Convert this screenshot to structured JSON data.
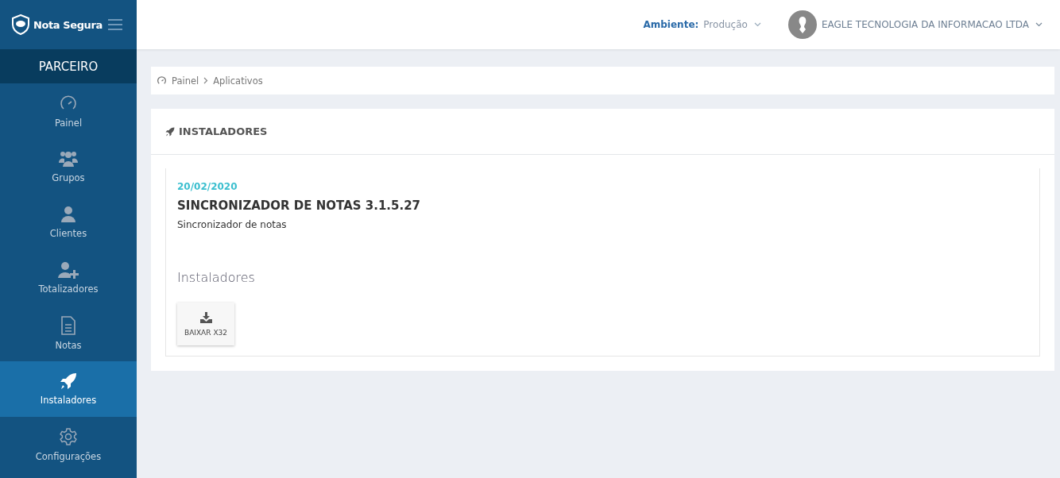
{
  "brand": {
    "name": "Nota Segura"
  },
  "sidebar": {
    "section": "PARCEIRO",
    "items": [
      {
        "label": "Painel",
        "selected": false
      },
      {
        "label": "Grupos",
        "selected": false
      },
      {
        "label": "Clientes",
        "selected": false
      },
      {
        "label": "Totalizadores",
        "selected": false
      },
      {
        "label": "Notas",
        "selected": false
      },
      {
        "label": "Instaladores",
        "selected": true
      },
      {
        "label": "Configurações",
        "selected": false
      }
    ]
  },
  "topbar": {
    "environment_label": "Ambiente:",
    "environment_value": "Produção",
    "company": "EAGLE TECNOLOGIA DA INFORMACAO LTDA"
  },
  "breadcrumb": [
    "Painel",
    "Aplicativos"
  ],
  "panel": {
    "title": "INSTALADORES",
    "entry": {
      "date": "20/02/2020",
      "name": "SINCRONIZADOR DE NOTAS 3.1.5.27",
      "description": "Sincronizador de notas",
      "installers_heading": "Instaladores",
      "downloads": [
        "BAIXAR X32"
      ]
    }
  }
}
